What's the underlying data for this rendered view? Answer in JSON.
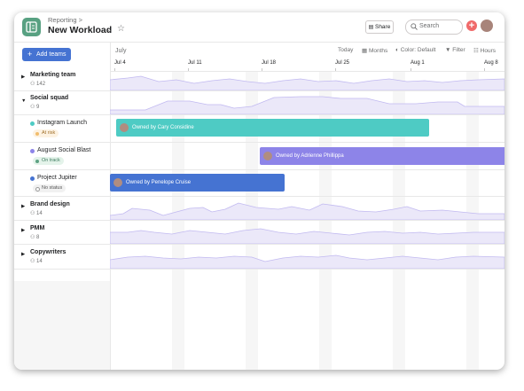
{
  "header": {
    "breadcrumb": "Reporting >",
    "title": "New Workload",
    "share_label": "Share",
    "search_placeholder": "Search"
  },
  "toolbar": {
    "add_teams_label": "Add teams",
    "month_label": "July",
    "today_label": "Today",
    "months_label": "Months",
    "color_label": "Color: Default",
    "filter_label": "Filter",
    "hours_label": "Hours"
  },
  "dates": [
    "Jul 4",
    "Jul 11",
    "Jul 18",
    "Jul 25",
    "Aug 1",
    "Aug 8"
  ],
  "teams": {
    "marketing": {
      "name": "Marketing team",
      "count": "142"
    },
    "social": {
      "name": "Social squad",
      "count": "9"
    },
    "brand": {
      "name": "Brand design",
      "count": "14"
    },
    "pmm": {
      "name": "PMM",
      "count": "8"
    },
    "copy": {
      "name": "Copywriters",
      "count": "14"
    }
  },
  "projects": {
    "instagram": {
      "name": "Instagram Launch",
      "status": "At risk",
      "bar_label": "Owned by Cary Considine"
    },
    "august": {
      "name": "August Social Blast",
      "status": "On track",
      "bar_label": "Owned by Adrienne Phillippa"
    },
    "jupiter": {
      "name": "Project Jupiter",
      "status": "No status",
      "bar_label": "Owned by Penelope Cruise"
    }
  },
  "colors": {
    "accent": "#4573d2",
    "instagram_bar": "#4ecbc4",
    "august_bar": "#8d84e8",
    "jupiter_bar": "#4573d2",
    "at_risk": "#f1bd6c",
    "on_track": "#5da283",
    "workload_fill": "#e8e5f8",
    "workload_line": "#b9b0ee"
  },
  "icons": [
    "app-icon",
    "chevron-down-icon",
    "star-icon",
    "share-icon",
    "search-icon",
    "plus-icon",
    "calendar-icon",
    "color-icon",
    "filter-icon",
    "hours-icon",
    "people-icon",
    "caret-right-icon",
    "caret-down-icon"
  ]
}
